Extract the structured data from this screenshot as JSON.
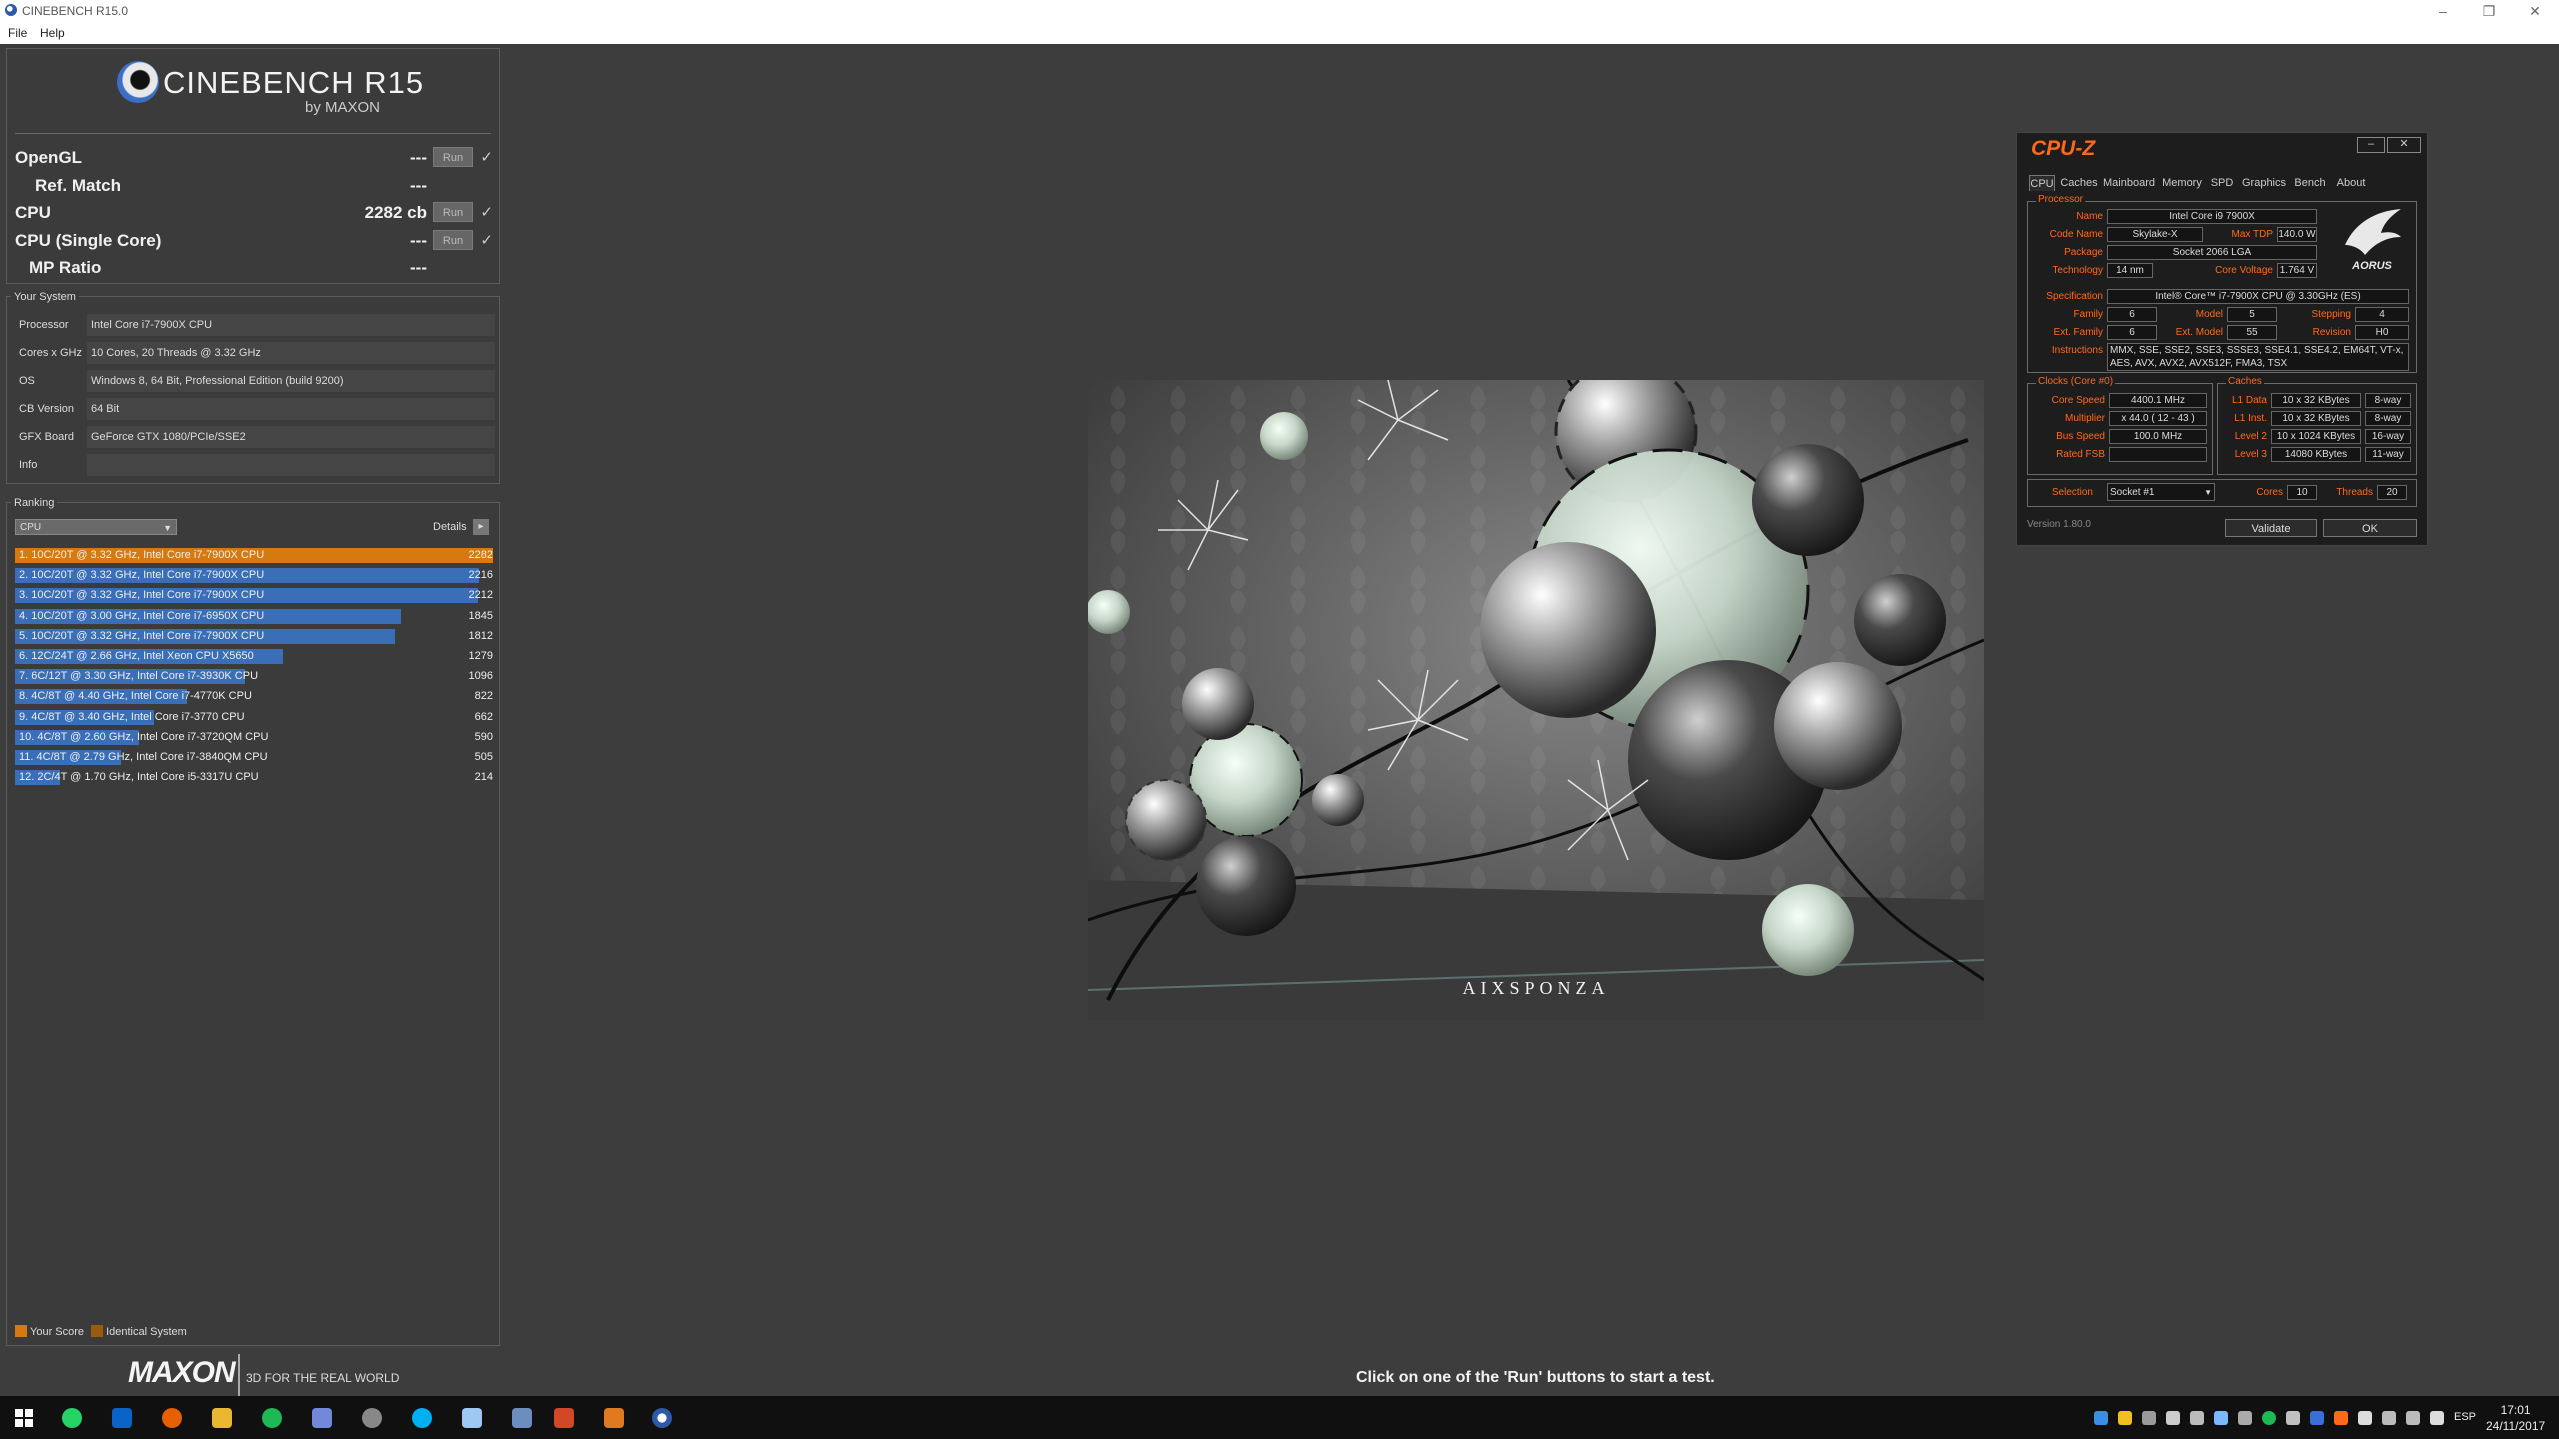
{
  "window": {
    "title": "CINEBENCH R15.0"
  },
  "menu": {
    "file": "File",
    "help": "Help"
  },
  "logo": {
    "main": "CINEBENCH R15",
    "sub": "by MAXON"
  },
  "benchmarks": [
    {
      "label": "OpenGL",
      "value": "---",
      "run": "Run",
      "check": "✓"
    },
    {
      "label": "Ref. Match",
      "value": "---"
    },
    {
      "label": "CPU",
      "value": "2282 cb",
      "run": "Run",
      "check": "✓"
    },
    {
      "label": "CPU (Single Core)",
      "value": "---",
      "run": "Run",
      "check": "✓"
    },
    {
      "label": "MP Ratio",
      "value": "---"
    }
  ],
  "system": {
    "title": "Your System",
    "rows": [
      {
        "key": "Processor",
        "value": "Intel Core i7-7900X CPU"
      },
      {
        "key": "Cores x GHz",
        "value": "10 Cores, 20 Threads @ 3.32 GHz"
      },
      {
        "key": "OS",
        "value": "Windows 8, 64 Bit, Professional Edition (build 9200)"
      },
      {
        "key": "CB Version",
        "value": "64 Bit"
      },
      {
        "key": "GFX Board",
        "value": "GeForce GTX 1080/PCIe/SSE2"
      },
      {
        "key": "Info",
        "value": ""
      }
    ]
  },
  "ranking": {
    "title": "Ranking",
    "select": "CPU",
    "details": "Details",
    "max_score": 2282,
    "rows": [
      {
        "text": "1. 10C/20T @ 3.32 GHz, Intel Core i7-7900X CPU",
        "score": 2282,
        "mine": true
      },
      {
        "text": "2. 10C/20T @ 3.32 GHz, Intel Core i7-7900X CPU",
        "score": 2216,
        "mine": false
      },
      {
        "text": "3. 10C/20T @ 3.32 GHz, Intel Core i7-7900X CPU",
        "score": 2212,
        "mine": false
      },
      {
        "text": "4. 10C/20T @ 3.00 GHz, Intel Core i7-6950X CPU",
        "score": 1845,
        "mine": false
      },
      {
        "text": "5. 10C/20T @ 3.32 GHz, Intel Core i7-7900X CPU",
        "score": 1812,
        "mine": false
      },
      {
        "text": "6. 12C/24T @ 2.66 GHz, Intel Xeon CPU X5650",
        "score": 1279,
        "mine": false
      },
      {
        "text": "7. 6C/12T @ 3.30 GHz,  Intel Core i7-3930K CPU",
        "score": 1096,
        "mine": false
      },
      {
        "text": "8. 4C/8T @ 4.40 GHz, Intel Core i7-4770K CPU",
        "score": 822,
        "mine": false
      },
      {
        "text": "9. 4C/8T @ 3.40 GHz,  Intel Core i7-3770 CPU",
        "score": 662,
        "mine": false
      },
      {
        "text": "10. 4C/8T @ 2.60 GHz, Intel Core i7-3720QM CPU",
        "score": 590,
        "mine": false
      },
      {
        "text": "11. 4C/8T @ 2.79 GHz,  Intel Core i7-3840QM CPU",
        "score": 505,
        "mine": false
      },
      {
        "text": "12. 2C/4T @ 1.70 GHz,  Intel Core i5-3317U CPU",
        "score": 214,
        "mine": false
      }
    ],
    "legend": {
      "your_score": "Your Score",
      "identical": "Identical System"
    }
  },
  "footer": {
    "maxon": "MAXON",
    "tagline": "3D FOR THE REAL WORLD",
    "hint": "Click on one of the 'Run' buttons to start a test."
  },
  "render": {
    "brand": "AIXSPONZA"
  },
  "cpuz": {
    "title": "CPU-Z",
    "tabs": [
      "CPU",
      "Caches",
      "Mainboard",
      "Memory",
      "SPD",
      "Graphics",
      "Bench",
      "About"
    ],
    "processor": {
      "group": "Processor",
      "name_label": "Name",
      "name": "Intel Core i9 7900X",
      "codename_label": "Code Name",
      "codename": "Skylake-X",
      "maxtdp_label": "Max TDP",
      "maxtdp": "140.0 W",
      "package_label": "Package",
      "package": "Socket 2066 LGA",
      "technology_label": "Technology",
      "technology": "14 nm",
      "voltage_label": "Core Voltage",
      "voltage": "1.764 V",
      "spec_label": "Specification",
      "spec": "Intel® Core™ i7-7900X CPU @ 3.30GHz (ES)",
      "family_label": "Family",
      "family": "6",
      "model_label": "Model",
      "model": "5",
      "stepping_label": "Stepping",
      "stepping": "4",
      "extfamily_label": "Ext. Family",
      "extfamily": "6",
      "extmodel_label": "Ext. Model",
      "extmodel": "55",
      "revision_label": "Revision",
      "revision": "H0",
      "instr_label": "Instructions",
      "instr_line1": "MMX, SSE, SSE2, SSE3, SSSE3, SSE4.1, SSE4.2, EM64T, VT-x,",
      "instr_line2": "AES, AVX, AVX2, AVX512F, FMA3, TSX",
      "logo": "AORUS"
    },
    "clocks": {
      "group": "Clocks (Core #0)",
      "speed_label": "Core Speed",
      "speed": "4400.1 MHz",
      "mult_label": "Multiplier",
      "mult": "x 44.0 ( 12 - 43 )",
      "bus_label": "Bus Speed",
      "bus": "100.0 MHz",
      "fsb_label": "Rated FSB",
      "fsb": ""
    },
    "caches": {
      "group": "Caches",
      "l1d_label": "L1 Data",
      "l1d": "10 x 32 KBytes",
      "l1d_way": "8-way",
      "l1i_label": "L1 Inst.",
      "l1i": "10 x 32 KBytes",
      "l1i_way": "8-way",
      "l2_label": "Level 2",
      "l2": "10 x 1024 KBytes",
      "l2_way": "16-way",
      "l3_label": "Level 3",
      "l3": "14080 KBytes",
      "l3_way": "11-way"
    },
    "selection_label": "Selection",
    "selection": "Socket #1",
    "cores_label": "Cores",
    "cores": "10",
    "threads_label": "Threads",
    "threads": "20",
    "version": "Version 1.80.0",
    "validate": "Validate",
    "ok": "OK"
  },
  "taskbar": {
    "lang": "ESP",
    "time": "17:01",
    "date": "24/11/2017"
  }
}
